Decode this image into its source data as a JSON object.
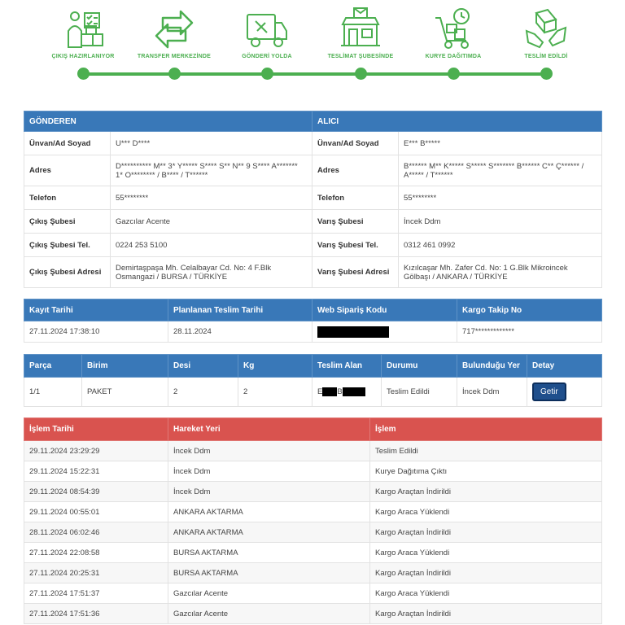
{
  "steps": [
    {
      "label": "ÇIKIŞ HAZIRLANIYOR",
      "icon": "package-preparing-icon"
    },
    {
      "label": "TRANSFER MERKEZİNDE",
      "icon": "transfer-arrows-icon"
    },
    {
      "label": "GÖNDERİ YOLDA",
      "icon": "delivery-truck-icon"
    },
    {
      "label": "TESLİMAT ŞUBESİNDE",
      "icon": "branch-store-icon"
    },
    {
      "label": "KURYE DAĞITIMDA",
      "icon": "courier-trolley-icon"
    },
    {
      "label": "TESLİM EDİLDİ",
      "icon": "handover-icon"
    }
  ],
  "colors": {
    "accent_green": "#4caf50",
    "header_blue": "#3978b8",
    "header_red": "#d9534f",
    "button": "#1f4f8c"
  },
  "parties": {
    "sender_title": "GÖNDEREN",
    "receiver_title": "ALICI",
    "rows": [
      {
        "s_label": "Ünvan/Ad Soyad",
        "s_value": "U*** D****",
        "r_label": "Ünvan/Ad Soyad",
        "r_value": "E*** B*****"
      },
      {
        "s_label": "Adres",
        "s_value": "D********** M** 3* Y***** S**** S** N** 9 S**** A******* 1* O******** / B**** / T******",
        "r_label": "Adres",
        "r_value": "B****** M** K***** S***** S******* B****** C** Ç****** / A***** / T******"
      },
      {
        "s_label": "Telefon",
        "s_value": "55********",
        "r_label": "Telefon",
        "r_value": "55********"
      },
      {
        "s_label": "Çıkış Şubesi",
        "s_value": "Gazcılar Acente",
        "r_label": "Varış Şubesi",
        "r_value": "İncek Ddm"
      },
      {
        "s_label": "Çıkış Şubesi Tel.",
        "s_value": "0224 253 5100",
        "r_label": "Varış Şubesi Tel.",
        "r_value": "0312 461 0992"
      },
      {
        "s_label": "Çıkış Şubesi Adresi",
        "s_value": "Demirtaşpaşa Mh. Celalbayar Cd. No: 4 F.Blk Osmangazi / BURSA / TÜRKİYE",
        "r_label": "Varış Şubesi Adresi",
        "r_value": "Kızılcaşar Mh. Zafer Cd. No: 1 G.Blk Mikroincek Gölbaşı / ANKARA / TÜRKİYE"
      }
    ]
  },
  "shipment": {
    "headers": [
      "Kayıt Tarihi",
      "Planlanan Teslim Tarihi",
      "Web Sipariş Kodu",
      "Kargo Takip No"
    ],
    "record_date": "27.11.2024 17:38:10",
    "planned_date": "28.11.2024",
    "tracking_no": "717*************"
  },
  "parcel": {
    "headers": [
      "Parça",
      "Birim",
      "Desi",
      "Kg",
      "Teslim Alan",
      "Durumu",
      "Bulunduğu Yer",
      "Detay"
    ],
    "piece": "1/1",
    "unit": "PAKET",
    "desi": "2",
    "kg": "2",
    "receiver_initial_1": "E",
    "receiver_initial_2": "B",
    "status": "Teslim Edildi",
    "location": "İncek Ddm",
    "detail_button": "Getir"
  },
  "history": {
    "headers": [
      "İşlem Tarihi",
      "Hareket Yeri",
      "İşlem"
    ],
    "rows": [
      {
        "date": "29.11.2024 23:29:29",
        "place": "İncek Ddm",
        "action": "Teslim Edildi"
      },
      {
        "date": "29.11.2024 15:22:31",
        "place": "İncek Ddm",
        "action": "Kurye Dağıtıma Çıktı"
      },
      {
        "date": "29.11.2024 08:54:39",
        "place": "İncek Ddm",
        "action": "Kargo Araçtan İndirildi"
      },
      {
        "date": "29.11.2024 00:55:01",
        "place": "ANKARA AKTARMA",
        "action": "Kargo Araca Yüklendi"
      },
      {
        "date": "28.11.2024 06:02:46",
        "place": "ANKARA AKTARMA",
        "action": "Kargo Araçtan İndirildi"
      },
      {
        "date": "27.11.2024 22:08:58",
        "place": "BURSA AKTARMA",
        "action": "Kargo Araca Yüklendi"
      },
      {
        "date": "27.11.2024 20:25:31",
        "place": "BURSA AKTARMA",
        "action": "Kargo Araçtan İndirildi"
      },
      {
        "date": "27.11.2024 17:51:37",
        "place": "Gazcılar Acente",
        "action": "Kargo Araca Yüklendi"
      },
      {
        "date": "27.11.2024 17:51:36",
        "place": "Gazcılar Acente",
        "action": "Kargo Araçtan İndirildi"
      }
    ]
  }
}
